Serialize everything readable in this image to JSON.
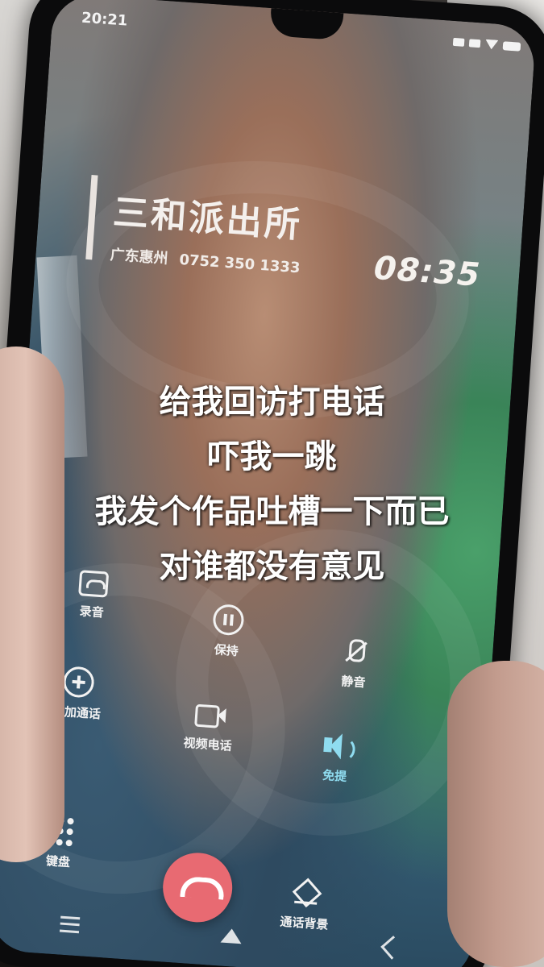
{
  "status_bar": {
    "time": "20:21"
  },
  "caller": {
    "name": "三和派出所",
    "location": "广东惠州",
    "number": "0752 350 1333",
    "call_duration": "08:35"
  },
  "subtitles": [
    "给我回访打电话",
    "吓我一跳",
    "我发个作品吐槽一下而已",
    "对谁都没有意见"
  ],
  "controls": {
    "record": "录音",
    "hold": "保持",
    "mute": "静音",
    "add_call": "添加通话",
    "video_call": "视频电话",
    "speaker": "免提",
    "keypad": "键盘",
    "call_background": "通话背景"
  },
  "colors": {
    "hangup": "#e86a72",
    "speaker_active": "#8fdcf0"
  },
  "icons": [
    "record-icon",
    "pause-icon",
    "mute-mic-icon",
    "add-icon",
    "video-camera-icon",
    "speaker-icon",
    "keypad-icon",
    "layers-icon",
    "hangup-phone-icon"
  ]
}
